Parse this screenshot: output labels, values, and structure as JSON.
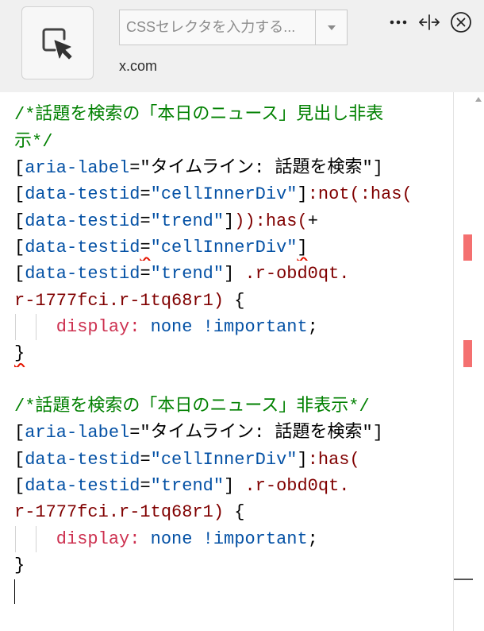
{
  "header": {
    "picker_button_icon": "element-picker-icon",
    "selector_input": {
      "value": "",
      "placeholder": "CSSセレクタを入力する..."
    },
    "selector_dropdown_icon": "caret-down-icon",
    "site": "x.com",
    "more_icon": "more-horizontal-icon",
    "resize_icon": "resize-horizontal-icon",
    "close_icon": "close-circle-icon"
  },
  "colors": {
    "comment": "#008000",
    "attribute": "#0451a5",
    "selector": "#800000",
    "property": "#cd3150",
    "value": "#0451a5",
    "punctuation": "#000000",
    "lint_error": "#e51400",
    "error_marker": "#f47070",
    "cursor_marker": "#555555"
  },
  "editor": {
    "lines": [
      {
        "tokens": [
          {
            "text": "/*話題を検索の「本日のニュース」見出し非表",
            "kind": "comment"
          }
        ]
      },
      {
        "tokens": [
          {
            "text": "示*/",
            "kind": "comment"
          }
        ]
      },
      {
        "tokens": [
          {
            "text": "[",
            "kind": "punctuation"
          },
          {
            "text": "aria-label",
            "kind": "attribute"
          },
          {
            "text": "=\"タイムライン: 話題を検索\"]",
            "kind": "punctuation"
          }
        ]
      },
      {
        "tokens": [
          {
            "text": "[",
            "kind": "punctuation"
          },
          {
            "text": "data-testid",
            "kind": "attribute"
          },
          {
            "text": "=",
            "kind": "punctuation"
          },
          {
            "text": "\"cellInnerDiv\"",
            "kind": "attribute"
          },
          {
            "text": "]",
            "kind": "punctuation"
          },
          {
            "text": ":not(:has(",
            "kind": "selector"
          }
        ]
      },
      {
        "tokens": [
          {
            "text": "[",
            "kind": "punctuation"
          },
          {
            "text": "data-testid",
            "kind": "attribute"
          },
          {
            "text": "=",
            "kind": "punctuation"
          },
          {
            "text": "\"trend\"",
            "kind": "attribute"
          },
          {
            "text": "]",
            "kind": "punctuation"
          },
          {
            "text": ")):has(",
            "kind": "selector"
          },
          {
            "text": "+",
            "kind": "punctuation"
          }
        ]
      },
      {
        "tokens": [
          {
            "text": "[",
            "kind": "punctuation"
          },
          {
            "text": "data-testid",
            "kind": "attribute"
          },
          {
            "text": "=",
            "kind": "punctuation",
            "lint": "error"
          },
          {
            "text": "\"cellInnerDiv\"",
            "kind": "attribute"
          },
          {
            "text": "]",
            "kind": "punctuation",
            "lint": "error"
          }
        ]
      },
      {
        "tokens": [
          {
            "text": "[",
            "kind": "punctuation"
          },
          {
            "text": "data-testid",
            "kind": "attribute"
          },
          {
            "text": "=",
            "kind": "punctuation"
          },
          {
            "text": "\"trend\"",
            "kind": "attribute"
          },
          {
            "text": "] ",
            "kind": "punctuation"
          },
          {
            "text": ".r-obd0qt.",
            "kind": "selector"
          }
        ]
      },
      {
        "tokens": [
          {
            "text": "r-1777fci.r-1tq68r1)",
            "kind": "selector"
          },
          {
            "text": " {",
            "kind": "punctuation"
          }
        ]
      },
      {
        "tokens": [
          {
            "text": "    display:",
            "kind": "property"
          },
          {
            "text": " none !important",
            "kind": "value"
          },
          {
            "text": ";",
            "kind": "punctuation"
          }
        ]
      },
      {
        "tokens": [
          {
            "text": "}",
            "kind": "punctuation",
            "lint": "error"
          }
        ]
      },
      {
        "tokens": []
      },
      {
        "tokens": [
          {
            "text": "/*話題を検索の「本日のニュース」非表示*/",
            "kind": "comment"
          }
        ]
      },
      {
        "tokens": [
          {
            "text": "[",
            "kind": "punctuation"
          },
          {
            "text": "aria-label",
            "kind": "attribute"
          },
          {
            "text": "=\"タイムライン: 話題を検索\"]",
            "kind": "punctuation"
          }
        ]
      },
      {
        "tokens": [
          {
            "text": "[",
            "kind": "punctuation"
          },
          {
            "text": "data-testid",
            "kind": "attribute"
          },
          {
            "text": "=",
            "kind": "punctuation"
          },
          {
            "text": "\"cellInnerDiv\"",
            "kind": "attribute"
          },
          {
            "text": "]",
            "kind": "punctuation"
          },
          {
            "text": ":has(",
            "kind": "selector"
          }
        ]
      },
      {
        "tokens": [
          {
            "text": "[",
            "kind": "punctuation"
          },
          {
            "text": "data-testid",
            "kind": "attribute"
          },
          {
            "text": "=",
            "kind": "punctuation"
          },
          {
            "text": "\"trend\"",
            "kind": "attribute"
          },
          {
            "text": "] ",
            "kind": "punctuation"
          },
          {
            "text": ".r-obd0qt.",
            "kind": "selector"
          }
        ]
      },
      {
        "tokens": [
          {
            "text": "r-1777fci.r-1tq68r1)",
            "kind": "selector"
          },
          {
            "text": " {",
            "kind": "punctuation"
          }
        ]
      },
      {
        "tokens": [
          {
            "text": "    display:",
            "kind": "property"
          },
          {
            "text": " none !important",
            "kind": "value"
          },
          {
            "text": ";",
            "kind": "punctuation"
          }
        ]
      },
      {
        "tokens": [
          {
            "text": "}",
            "kind": "punctuation"
          }
        ]
      },
      {
        "tokens": [],
        "cursor": true
      }
    ]
  }
}
